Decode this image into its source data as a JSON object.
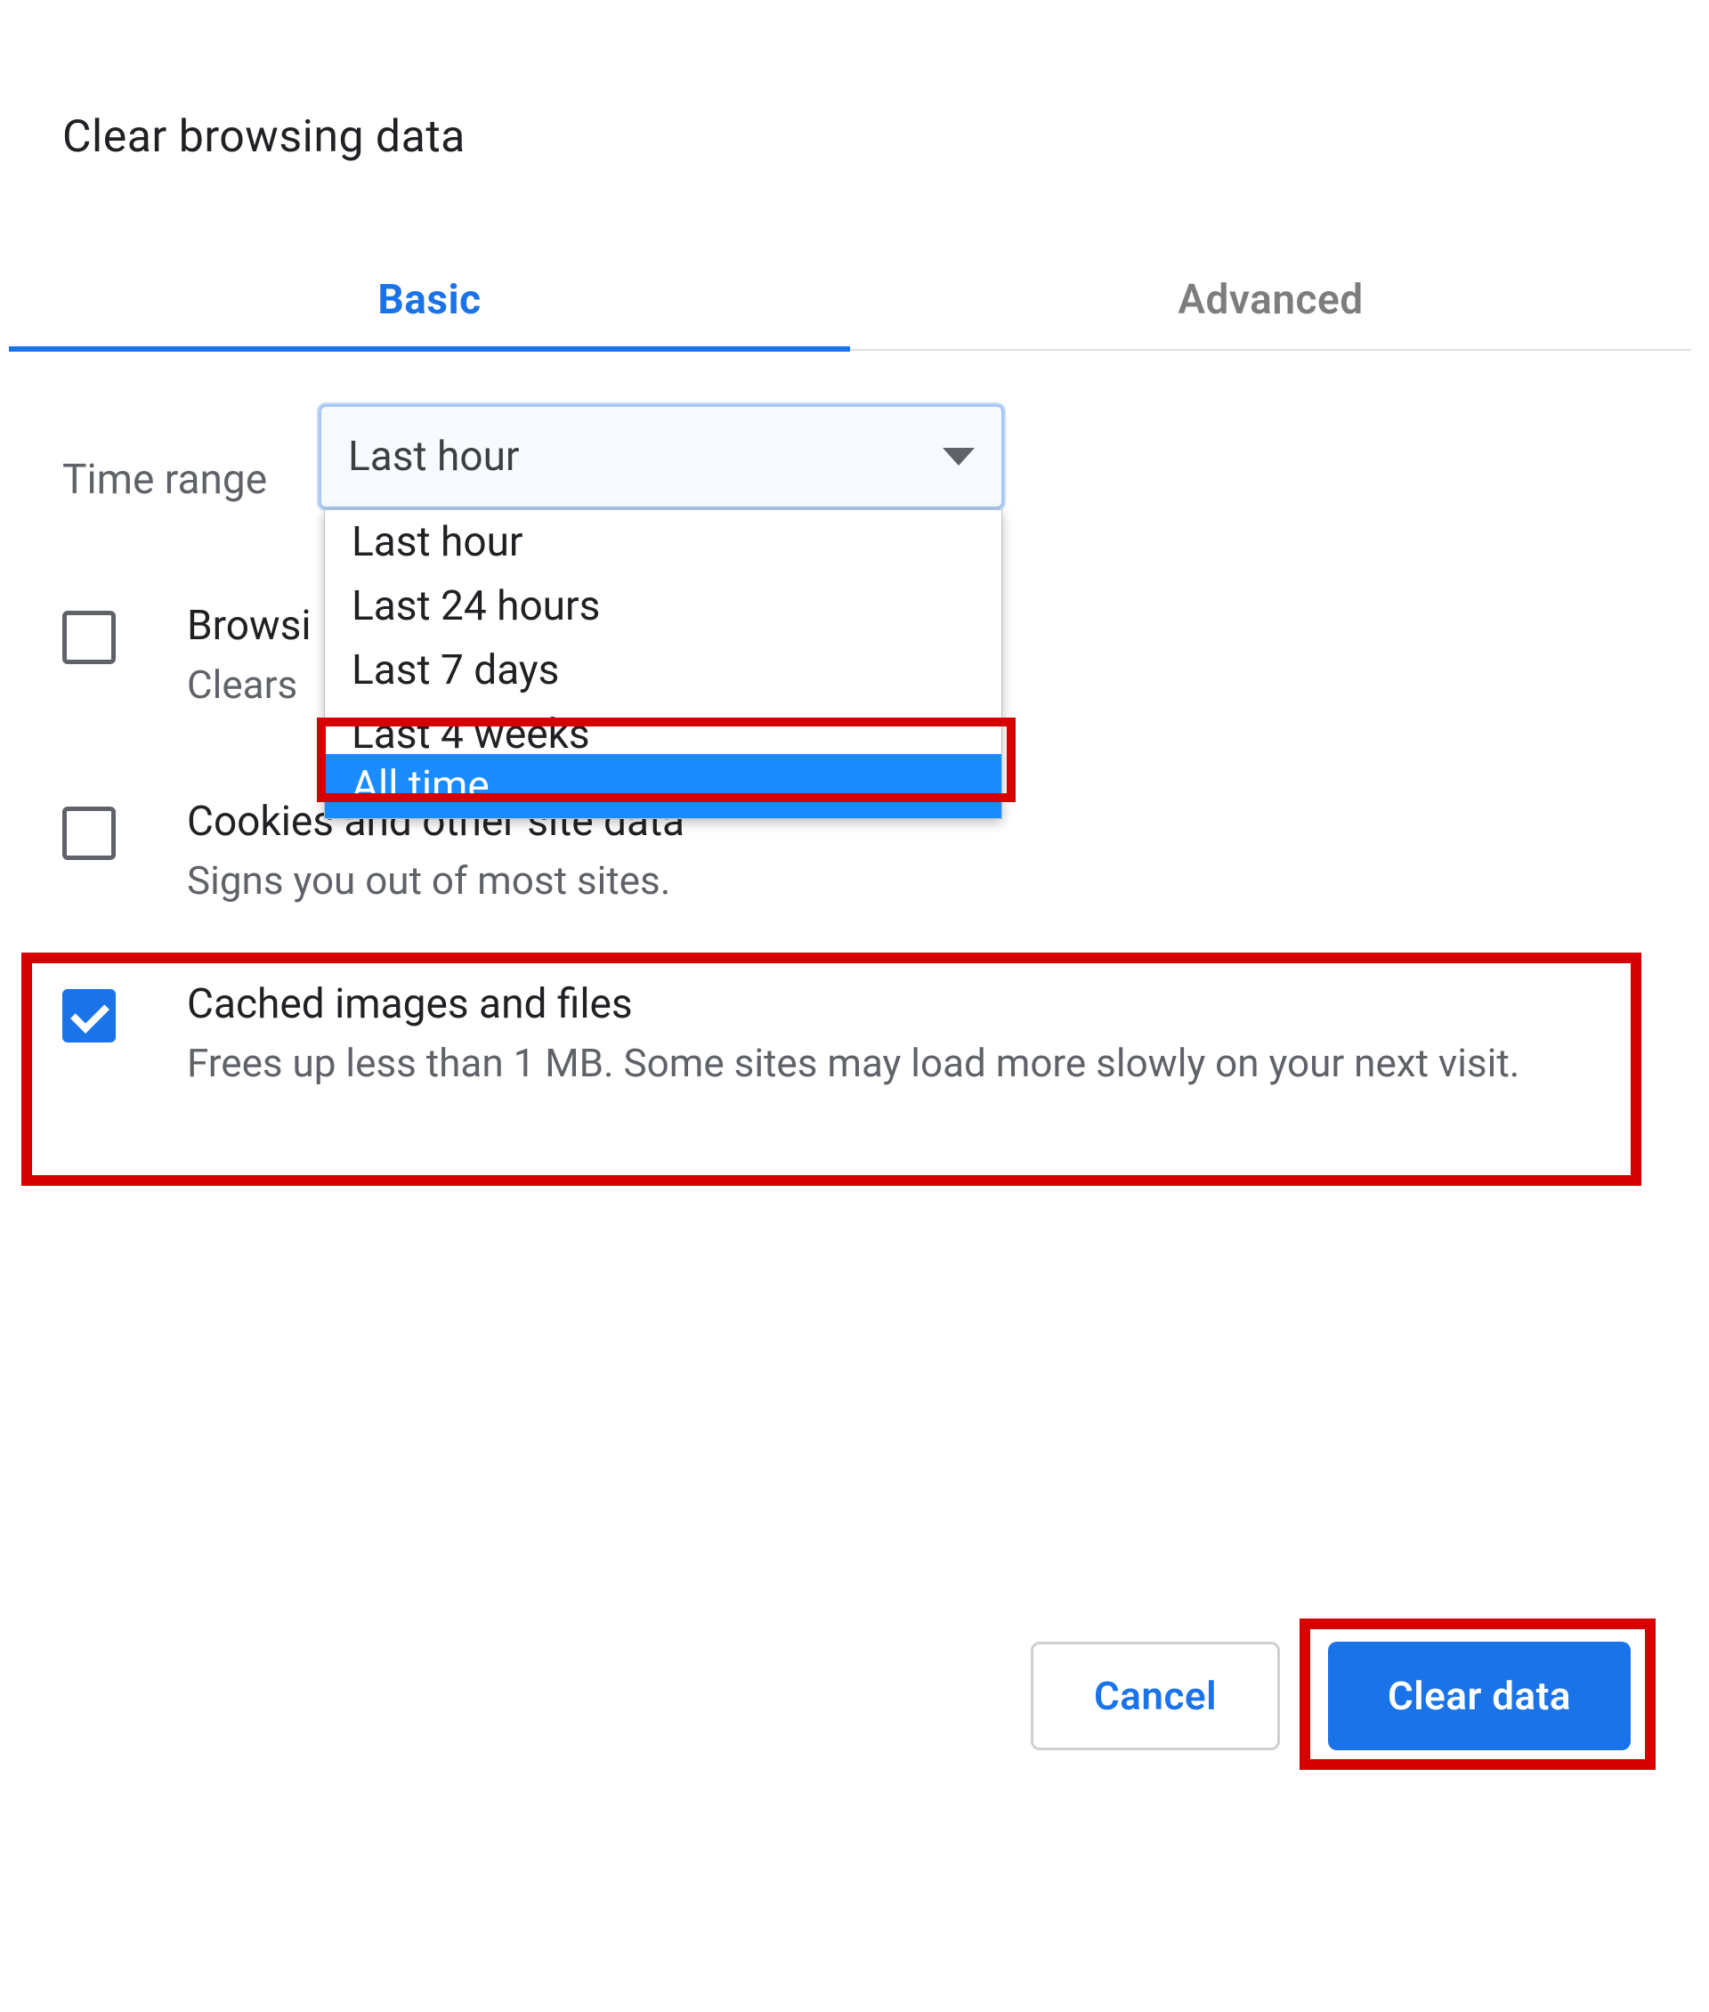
{
  "dialog": {
    "title": "Clear browsing data"
  },
  "tabs": {
    "basic": "Basic",
    "advanced": "Advanced",
    "active": "basic"
  },
  "timerange": {
    "label": "Time range",
    "selected": "Last hour",
    "options": [
      "Last hour",
      "Last 24 hours",
      "Last 7 days",
      "Last 4 weeks",
      "All time"
    ],
    "highlighted_option": "All time"
  },
  "options": {
    "browsing_history": {
      "checked": false,
      "title": "Browsing history",
      "title_visible": "Browsi",
      "description": "Clears history and autocompletions in the address bar.",
      "description_visible": "Clears "
    },
    "cookies": {
      "checked": false,
      "title": "Cookies and other site data",
      "description": "Signs you out of most sites."
    },
    "cached": {
      "checked": true,
      "title": "Cached images and files",
      "description": "Frees up less than 1 MB. Some sites may load more slowly on your next visit."
    }
  },
  "buttons": {
    "cancel": "Cancel",
    "clear": "Clear data"
  }
}
